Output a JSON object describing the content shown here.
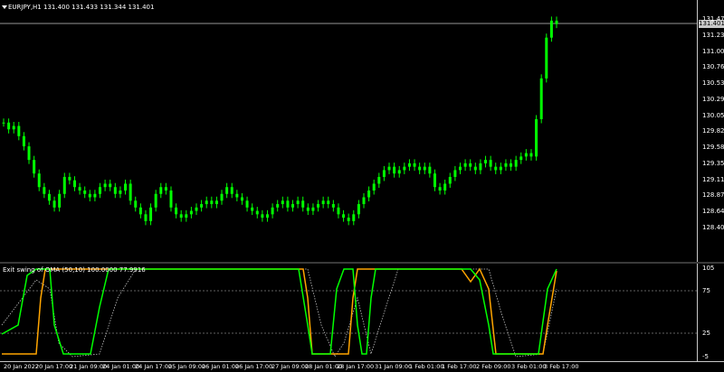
{
  "chart": {
    "title": "EURJPY,H1  131.400 131.433 131.344 131.401",
    "current_price": "131.401",
    "colors": {
      "candle": "#00ff00",
      "grid": "#808080",
      "price_line": "#c8c8c8"
    }
  },
  "main_scale": [
    "131.475",
    "131.235",
    "131.000",
    "130.765",
    "130.530",
    "130.295",
    "130.055",
    "129.820",
    "129.585",
    "129.350",
    "129.110",
    "128.875",
    "128.640",
    "128.405"
  ],
  "indicator": {
    "title": "Exit swing of OMA (50,10) 100.0000 77.9916",
    "scale": [
      "105",
      "75",
      "25",
      "-5"
    ],
    "colors": {
      "fast": "#00ff00",
      "slow": "#ffa500",
      "dotted": "#c0c0c0"
    }
  },
  "time_axis": [
    "20 Jan 2022",
    "20 Jan 17:00",
    "21 Jan 09:00",
    "24 Jan 01:00",
    "24 Jan 17:00",
    "25 Jan 09:00",
    "26 Jan 01:00",
    "26 Jan 17:00",
    "27 Jan 09:00",
    "28 Jan 01:00",
    "28 Jan 17:00",
    "31 Jan 09:00",
    "1 Feb 01:00",
    "1 Feb 17:00",
    "2 Feb 09:00",
    "3 Feb 01:00",
    "3 Feb 17:00"
  ],
  "chart_data": {
    "type": "line",
    "series": [
      {
        "values": [
          129.95,
          129.85,
          129.9,
          129.75,
          129.6,
          129.4,
          129.2,
          129.0,
          128.9,
          128.8,
          128.7,
          128.9,
          129.15,
          129.1,
          129.0,
          128.95,
          128.9,
          128.85,
          128.9,
          129.0,
          129.05,
          129.0,
          128.9,
          128.95,
          129.05,
          128.8,
          128.7,
          128.6,
          128.5,
          128.7,
          128.9,
          129.0,
          128.95,
          128.7,
          128.6,
          128.55,
          128.6,
          128.65,
          128.7,
          128.75,
          128.8,
          128.75,
          128.8,
          128.9,
          129.0,
          128.9,
          128.85,
          128.8,
          128.7,
          128.65,
          128.6,
          128.55,
          128.6,
          128.7,
          128.75,
          128.8,
          128.7,
          128.75,
          128.8,
          128.7,
          128.65,
          128.7,
          128.75,
          128.8,
          128.75,
          128.7,
          128.6,
          128.55,
          128.5,
          128.6,
          128.75,
          128.85,
          128.95,
          129.05,
          129.15,
          129.25,
          129.3,
          129.2,
          129.25,
          129.3,
          129.35,
          129.3,
          129.25,
          129.3,
          129.2,
          129.0,
          128.95,
          129.05,
          129.15,
          129.25,
          129.3,
          129.35,
          129.3,
          129.25,
          129.35,
          129.4,
          129.3,
          129.25,
          129.3,
          129.35,
          129.3,
          129.4,
          129.45,
          129.5,
          129.45,
          130.0,
          130.6,
          131.2,
          131.45,
          131.4
        ]
      }
    ]
  }
}
